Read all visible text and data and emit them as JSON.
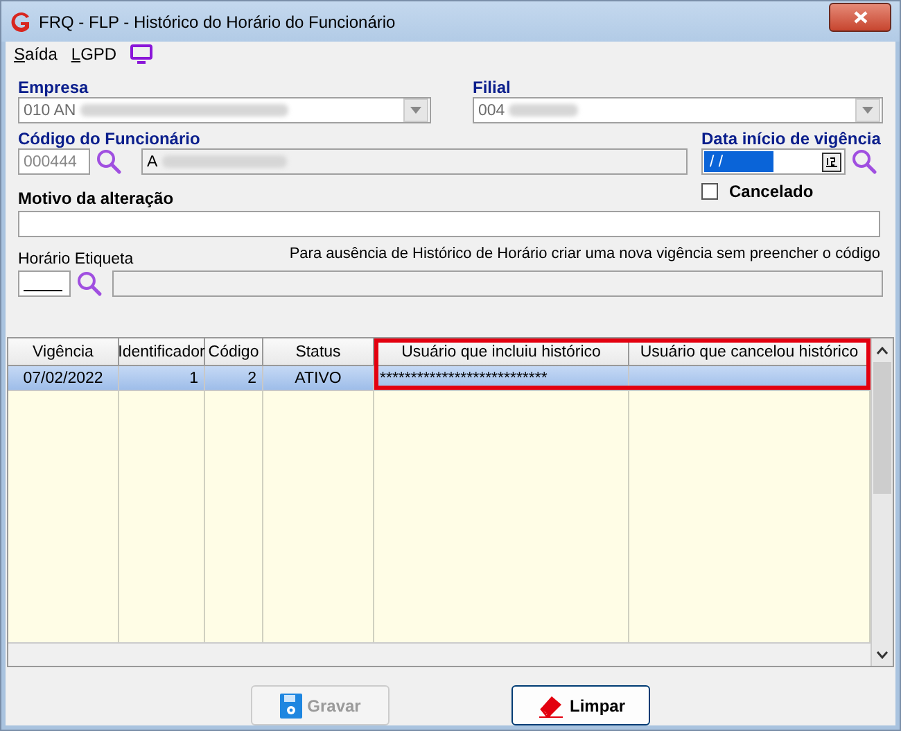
{
  "window": {
    "title": "FRQ - FLP - Histórico do Horário do Funcionário"
  },
  "menu": [
    {
      "label": "Saída"
    },
    {
      "label": "LGPD"
    }
  ],
  "empresa": {
    "label": "Empresa",
    "value": "010 AN"
  },
  "filial": {
    "label": "Filial",
    "value": "004"
  },
  "funcionario": {
    "label": "Código do Funcionário",
    "code": "000444",
    "name": "A"
  },
  "data_inicio": {
    "label": "Data início de vigência",
    "value": "/ /"
  },
  "cancelado": {
    "label": "Cancelado",
    "checked": false
  },
  "motivo": {
    "label": "Motivo da alteração"
  },
  "horario": {
    "label": "Horário Etiqueta",
    "hint": "Para ausência de Histórico de Horário criar uma nova vigência sem preencher o código"
  },
  "table": {
    "columns": [
      "Vigência",
      "Identificador",
      "Código",
      "Status",
      "Usuário que incluiu histórico",
      "Usuário que cancelou histórico"
    ],
    "rows": [
      {
        "selected": true,
        "cells": [
          "07/02/2022",
          "1",
          "2",
          "ATIVO",
          "***************************",
          ""
        ]
      }
    ]
  },
  "buttons": [
    {
      "label": "Gravar",
      "disabled": true,
      "kind": "save"
    },
    {
      "label": "Limpar",
      "disabled": false,
      "kind": "clear"
    }
  ]
}
